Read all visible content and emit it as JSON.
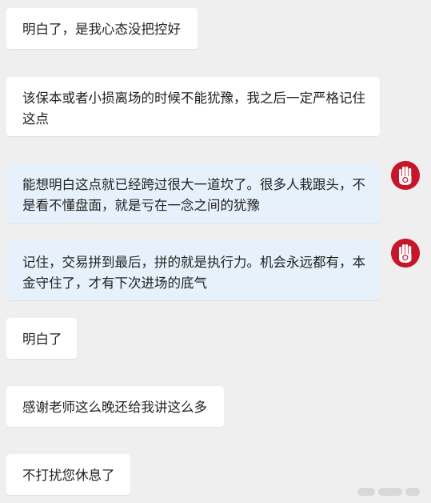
{
  "chat": {
    "messages": [
      {
        "sender": "user",
        "text": "明白了，是我心态没把控好"
      },
      {
        "sender": "user",
        "text": "该保本或者小损离场的时候不能犹豫，我之后一定严格记住这点"
      },
      {
        "sender": "teacher",
        "text": "能想明白这点就已经跨过很大一道坎了。很多人栽跟头，不是看不懂盘面，就是亏在一念之间的犹豫"
      },
      {
        "sender": "teacher",
        "text": "记住，交易拼到最后，拼的就是执行力。机会永远都有，本金守住了，才有下次进场的底气"
      },
      {
        "sender": "user",
        "text": "明白了"
      },
      {
        "sender": "user",
        "text": "感谢老师这么晚还给我讲这么多"
      },
      {
        "sender": "user",
        "text": "不打扰您休息了"
      }
    ]
  },
  "colors": {
    "background": "#efefef",
    "user_bubble": "#ffffff",
    "teacher_bubble": "#e6f1fc",
    "avatar": "#c7162b",
    "text": "#222222"
  },
  "icons": {
    "teacher_avatar": "red-hand-stop-icon"
  }
}
